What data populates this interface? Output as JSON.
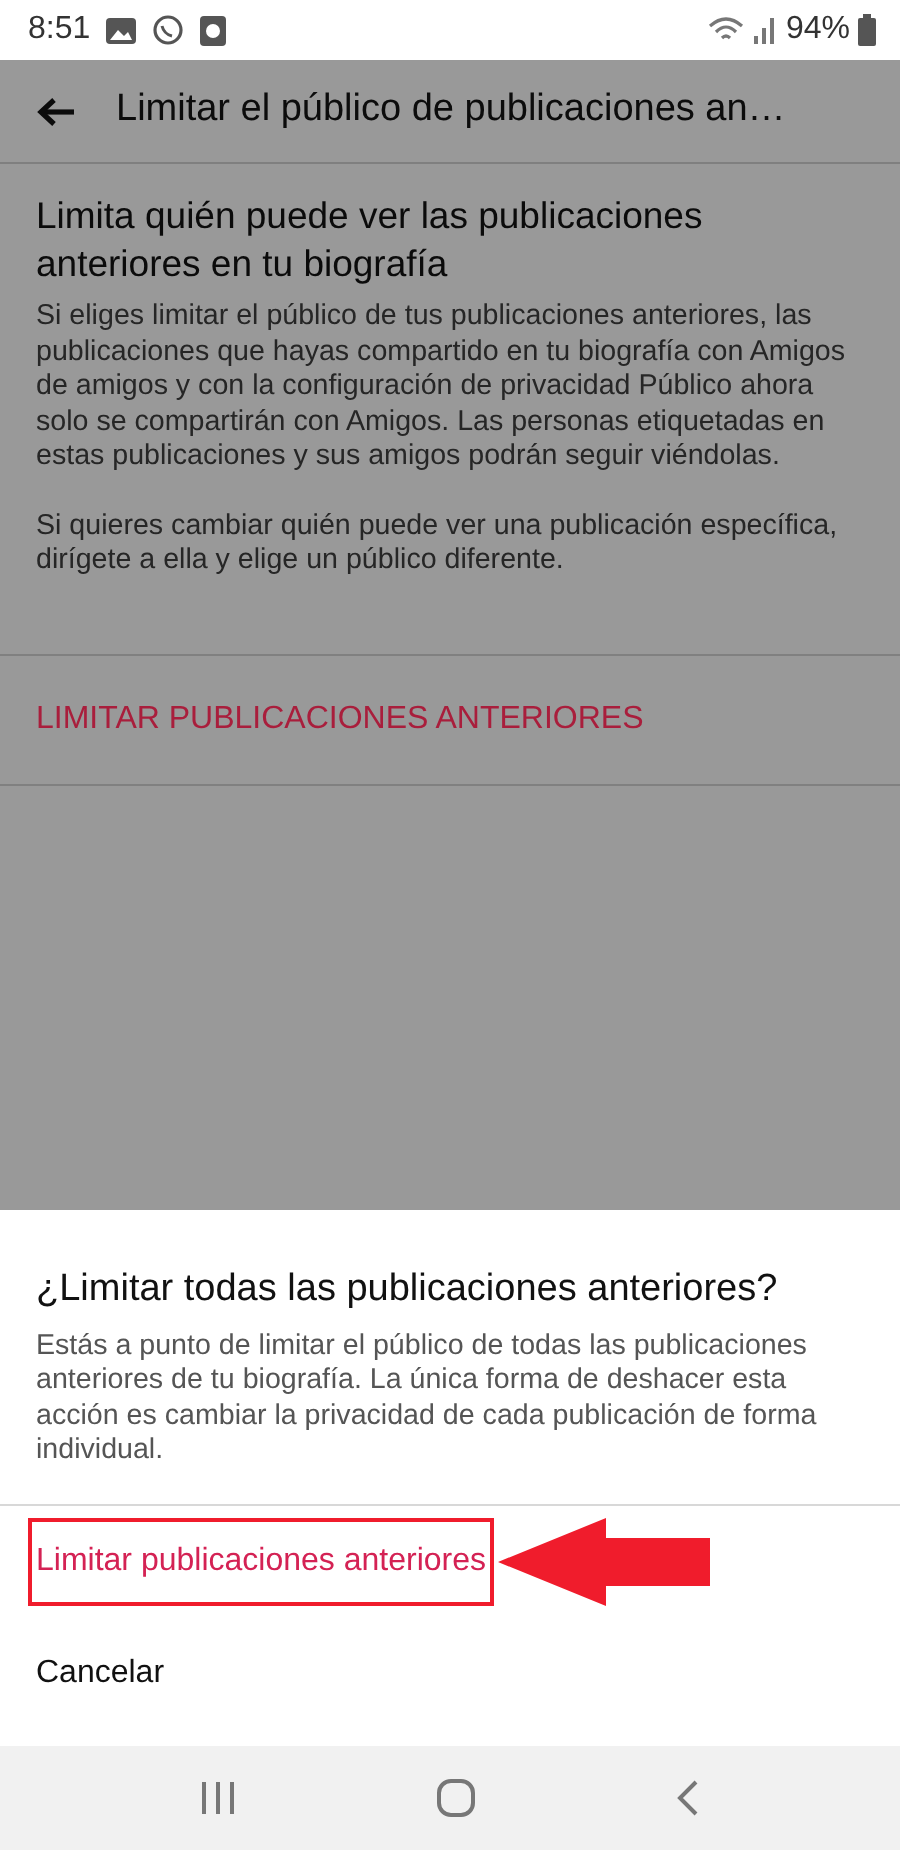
{
  "status_bar": {
    "time": "8:51",
    "battery": "94%"
  },
  "app_bar": {
    "title": "Limitar el público de publicaciones an…"
  },
  "content": {
    "heading": "Limita quién puede ver las publicaciones anteriores en tu biografía",
    "paragraphs": [
      "Si eliges limitar el público de tus publicaciones anteriores, las publicaciones que hayas compartido en tu biografía con Amigos de amigos y con la configuración de privacidad Público ahora solo se compartirán con Amigos. Las personas etiquetadas en estas publicaciones y sus amigos podrán seguir viéndolas.",
      "Si quieres cambiar quién puede ver una publicación específica, dirígete a ella y elige un público diferente."
    ],
    "action": "LIMITAR PUBLICACIONES ANTERIORES"
  },
  "dialog": {
    "title": "¿Limitar todas las publicaciones anteriores?",
    "message": "Estás a punto de limitar el público de todas las publicaciones anteriores de tu biografía. La única forma de deshacer esta acción es cambiar la privacidad de cada publicación de forma individual.",
    "actions": [
      {
        "label": "Limitar publicaciones anteriores",
        "kind": "primary",
        "highlighted": true
      },
      {
        "label": "Cancelar",
        "kind": "secondary",
        "highlighted": false
      }
    ]
  }
}
